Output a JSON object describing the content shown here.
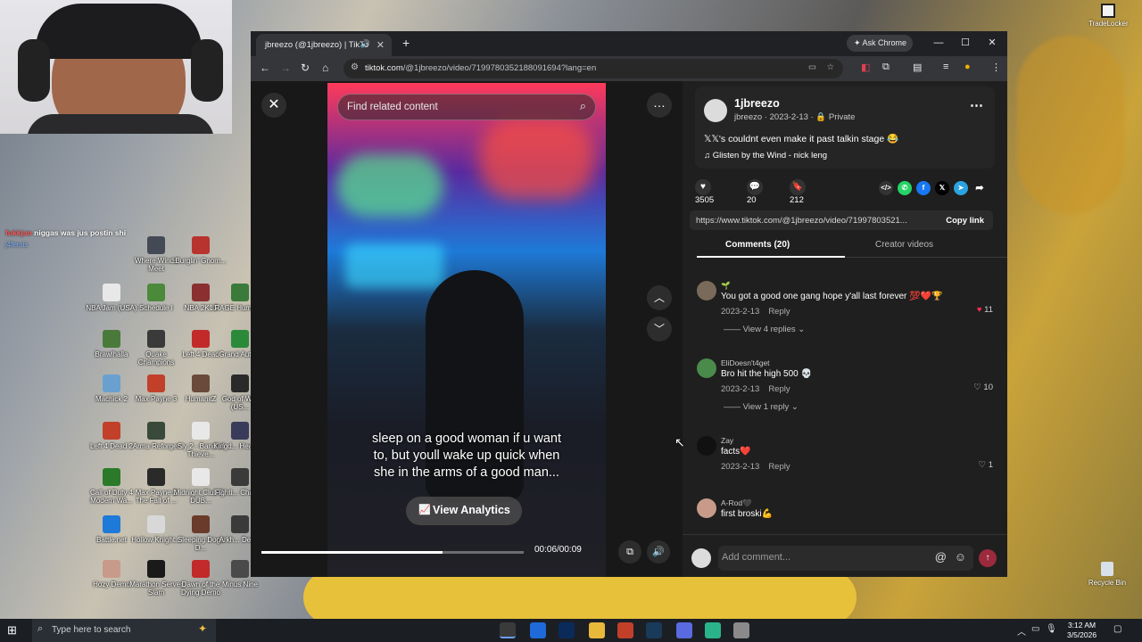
{
  "overlay": {
    "chat": {
      "user": "fukkjan",
      "message": "niggas was jus postin shi",
      "user2": "j4femis"
    }
  },
  "desktop": {
    "icons": [
      {
        "label": "Where Winds Meet",
        "color": "#444a55"
      },
      {
        "label": "Burglin' Gnom...",
        "color": "#b8322e"
      },
      {
        "label": "NBA Jam (USA)",
        "color": "#e8e8e8"
      },
      {
        "label": "Schedule I",
        "color": "#4a8a3a"
      },
      {
        "label": "NBA 2K13",
        "color": "#8a3030"
      },
      {
        "label": "RAGE Human...",
        "color": "#3a7a3a"
      },
      {
        "label": "Brawlhalla",
        "color": "#4a7a3a"
      },
      {
        "label": "Quake Champions",
        "color": "#3a3a3a"
      },
      {
        "label": "Left 4 Dead",
        "color": "#c22a2a"
      },
      {
        "label": "Grand Auto...",
        "color": "#2a8a3a"
      },
      {
        "label": "Machick 2",
        "color": "#6aa0d0"
      },
      {
        "label": "Max Payne 3",
        "color": "#c2402a"
      },
      {
        "label": "HumanitZ",
        "color": "#6a4a3a"
      },
      {
        "label": "God of War (US...",
        "color": "#2a2a2a"
      },
      {
        "label": "Left 4 Dead 2",
        "color": "#c2402a"
      },
      {
        "label": "Arma Reforger",
        "color": "#3a4a3a"
      },
      {
        "label": "Sly 2 - Band of Thieve...",
        "color": "#e8e8e8"
      },
      {
        "label": "Kingd... Hearts...",
        "color": "#3a3a5a"
      },
      {
        "label": "Call of Duty 4 Modern Wa...",
        "color": "#2a7a2a"
      },
      {
        "label": "Max Payne 2 The Fall of ...",
        "color": "#2a2a2a"
      },
      {
        "label": "Midnight Club 3 - DUB...",
        "color": "#e8e8e8"
      },
      {
        "label": "Fighti... Cham...",
        "color": "#3a3a3a"
      },
      {
        "label": "Battle.net",
        "color": "#1e7ad8"
      },
      {
        "label": "Hollow Knight...",
        "color": "#d8d8d8"
      },
      {
        "label": "Sleeping Dogs D...",
        "color": "#6a3a2a"
      },
      {
        "label": "Arkh... Den...",
        "color": "#3a3a3a"
      },
      {
        "label": "Hozy Demo",
        "color": "#c89a8a"
      },
      {
        "label": "Marathon Server Slam",
        "color": "#1a1a1a"
      },
      {
        "label": "Dawn of the Dying Demo",
        "color": "#c22a2a"
      },
      {
        "label": "Minus Nine",
        "color": "#4a4a4a"
      }
    ],
    "tradelocker_label": "TradeLocker",
    "recycle_label": "Recycle Bin"
  },
  "browser": {
    "tab_title": "jbreezo (@1jbreezo) | TikTo",
    "ask_chrome": "Ask Chrome",
    "url_host": "tiktok.com",
    "url_path": "/@1jbreezo/video/7199780352188091694?lang=en"
  },
  "video": {
    "search_placeholder": "Find related content",
    "caption": "sleep on a good woman if u want to, but youll wake up quick when she in the arms of a good man...",
    "analytics_label": "View Analytics",
    "time": "00:06/00:09",
    "progress_fraction": 0.69
  },
  "post": {
    "display_name": "1jbreezo",
    "handle": "jbreezo",
    "date": "2023-2-13",
    "privacy": "Private",
    "description": "𝕏𝕏's couldnt even make it past talkin stage 😂",
    "music": "Glisten by the Wind - nick leng",
    "likes": "3505",
    "comments": "20",
    "saves": "212",
    "link": "https://www.tiktok.com/@1jbreezo/video/71997803521...",
    "copy_link": "Copy link",
    "tab_comments": "Comments (20)",
    "tab_creator": "Creator videos"
  },
  "comments": [
    {
      "user": "🌱",
      "text": "You got a good one gang hope y'all last forever 💯❤️🏆",
      "date": "2023-2-13",
      "reply": "Reply",
      "likes": "11",
      "liked": true,
      "view_replies": "View 4 replies",
      "avatar": "#7a6a5a"
    },
    {
      "user": "EliDoesn't4get",
      "text": "Bro hit the high 500 💀",
      "date": "2023-2-13",
      "reply": "Reply",
      "likes": "10",
      "liked": false,
      "view_replies": "View 1 reply",
      "avatar": "#4a8a4a"
    },
    {
      "user": "Zay",
      "text": "facts❤️",
      "date": "2023-2-13",
      "reply": "Reply",
      "likes": "1",
      "liked": false,
      "view_replies": "",
      "avatar": "#111111"
    },
    {
      "user": "A-Rod🖤",
      "text": "first broski💪",
      "date": "",
      "reply": "",
      "likes": "",
      "liked": false,
      "view_replies": "",
      "avatar": "#c89a8a"
    }
  ],
  "comment_input": {
    "placeholder": "Add comment..."
  },
  "taskbar": {
    "search_placeholder": "Type here to search",
    "time": "3:12 AM",
    "date": "3/5/2026"
  }
}
